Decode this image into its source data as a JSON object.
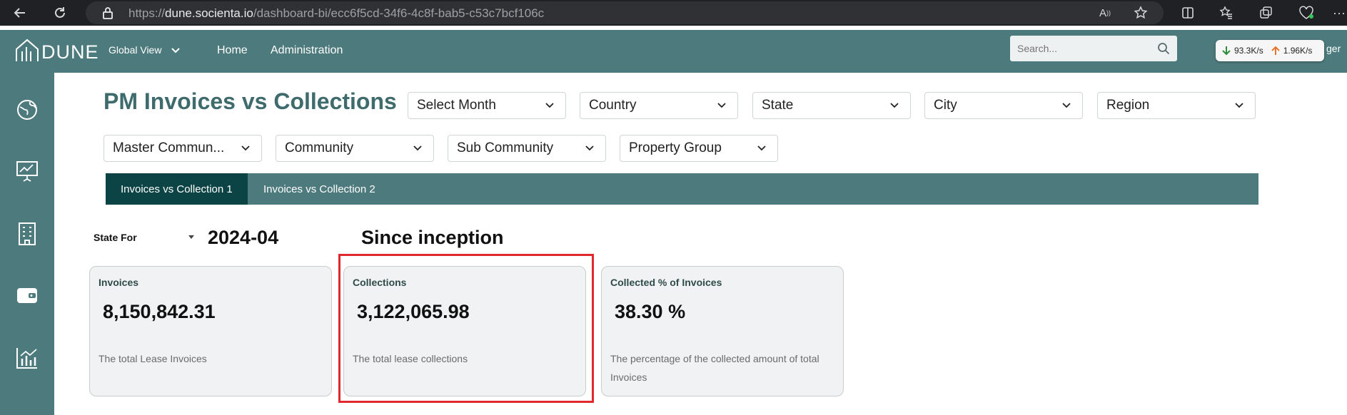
{
  "browser": {
    "url_prefix": "https://",
    "url_host": "dune.socienta.io",
    "url_path": "/dashboard-bi/ecc6f5cd-34f6-4c8f-bab5-c53c7bcf106c",
    "icons": [
      "back-icon",
      "refresh-icon",
      "lock-icon",
      "read-aloud-icon",
      "star-icon",
      "split-screen-icon",
      "favorites-icon",
      "collections-icon",
      "health-icon",
      "more-icon"
    ]
  },
  "header": {
    "logo_text": "DUNE",
    "global_view": "Global View",
    "nav": [
      "Home",
      "Administration"
    ],
    "search_placeholder": "Search...",
    "net_down": "93.3K/s",
    "net_up": "1.96K/s",
    "user_fragment": "ger"
  },
  "sidebar": {
    "icons": [
      "globe-icon",
      "presentation-icon",
      "building-icon",
      "wallet-icon",
      "analytics-icon"
    ]
  },
  "page": {
    "title": "PM Invoices vs Collections"
  },
  "filters": {
    "row1": [
      "Select Month",
      "Country",
      "State",
      "City",
      "Region"
    ],
    "row2": [
      "Master Commun...",
      "Community",
      "Sub Community",
      "Property Group"
    ]
  },
  "tabs": [
    {
      "label": "Invoices vs Collection 1",
      "active": true
    },
    {
      "label": "Invoices vs Collection 2",
      "active": false
    }
  ],
  "state": {
    "label": "State For",
    "value": "2024-04",
    "since": "Since inception"
  },
  "cards": [
    {
      "title": "Invoices",
      "value": "8,150,842.31",
      "desc": "The total Lease Invoices"
    },
    {
      "title": "Collections",
      "value": "3,122,065.98",
      "desc": "The total lease collections"
    },
    {
      "title": "Collected % of Invoices",
      "value": "38.30 %",
      "desc": "The percentage of the collected amount of total Invoices"
    }
  ],
  "colors": {
    "brand": "#4d7a7c",
    "tab_active": "#0c4446",
    "title": "#3f6b6d",
    "highlight": "#e0282e"
  }
}
